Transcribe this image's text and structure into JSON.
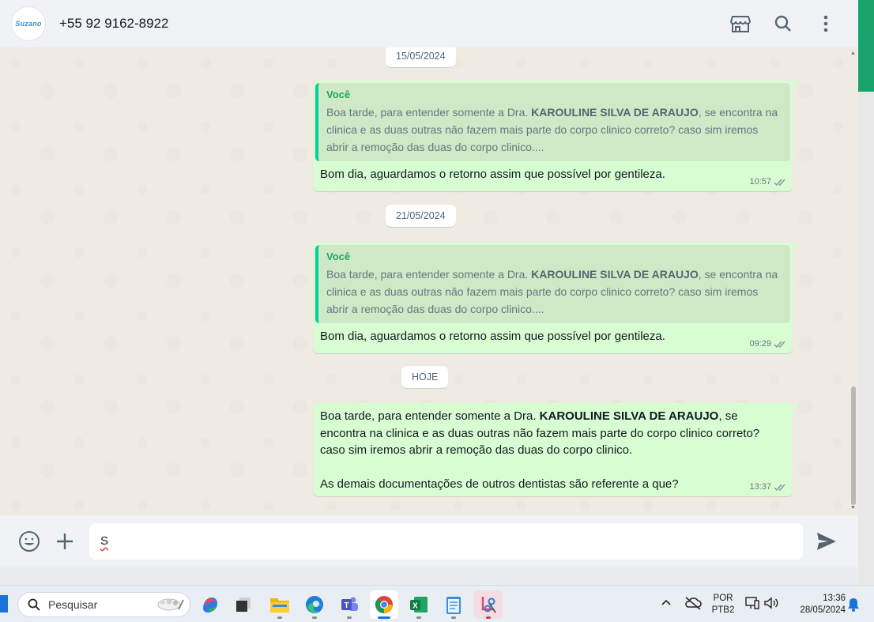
{
  "header": {
    "avatar_text": "Suzano",
    "contact": "+55 92 9162-8922",
    "icons": [
      "store-icon",
      "search-icon",
      "more-options-icon"
    ]
  },
  "chat": {
    "date1": "15/05/2024",
    "date2": "21/05/2024",
    "date3": "HOJE",
    "msg1": {
      "quote_author": "Você",
      "quote_pre": "Boa tarde, para entender somente a Dra. ",
      "quote_bold": "KAROULINE SILVA DE ARAUJO",
      "quote_post": ", se encontra na clinica e as duas outras não fazem mais parte do corpo clinico correto? caso sim iremos abrir a remoção das duas do corpo clinico....",
      "text": "Bom dia, aguardamos o retorno assim que possível por gentileza.",
      "time": "10:57"
    },
    "msg2": {
      "quote_author": "Você",
      "quote_pre": "Boa tarde, para entender somente a Dra. ",
      "quote_bold": "KAROULINE SILVA DE ARAUJO",
      "quote_post": ", se encontra na clinica e as duas outras não fazem mais parte do corpo clinico correto? caso sim iremos abrir a remoção das duas do corpo clinico....",
      "text": "Bom dia, aguardamos o retorno assim que possível por gentileza.",
      "time": "09:29"
    },
    "msg3": {
      "pre": "Boa tarde, para entender somente a Dra. ",
      "bold": "KAROULINE SILVA DE ARAUJO",
      "post": ", se encontra na clinica e as duas outras não fazem mais parte do corpo clinico correto? caso sim iremos abrir a remoção das duas do corpo clinico.",
      "line2": "As demais documentações de outros dentistas são referente a que?",
      "time": "13:37"
    }
  },
  "composer": {
    "input_value": "S"
  },
  "taskbar": {
    "search_label": "Pesquisar",
    "apps": [
      "copilot",
      "task-view",
      "file-explorer",
      "edge",
      "teams",
      "chrome",
      "excel",
      "notepad",
      "snipping-tool"
    ],
    "lang_top": "POR",
    "lang_bottom": "PTB2",
    "time": "13:36",
    "date": "28/05/2024"
  },
  "colors": {
    "bubble": "#d9fdd3",
    "quote_bar": "#06cf9c",
    "chat_bg": "#efeae2",
    "send": "#8696a0"
  }
}
